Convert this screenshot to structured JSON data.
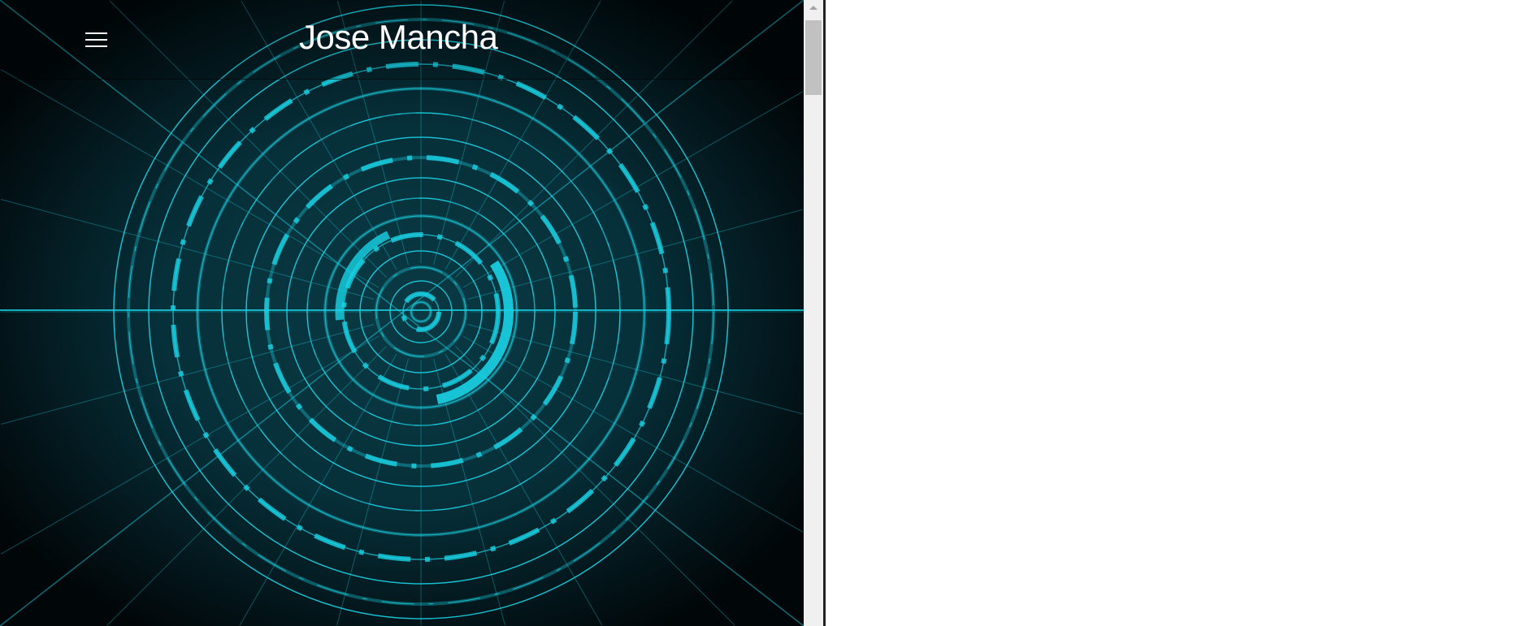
{
  "header": {
    "title": "Jose Mancha",
    "menu_icon": "hamburger-menu-icon"
  },
  "theme": {
    "accent": "#19d3e6",
    "background": "#020a0d"
  }
}
